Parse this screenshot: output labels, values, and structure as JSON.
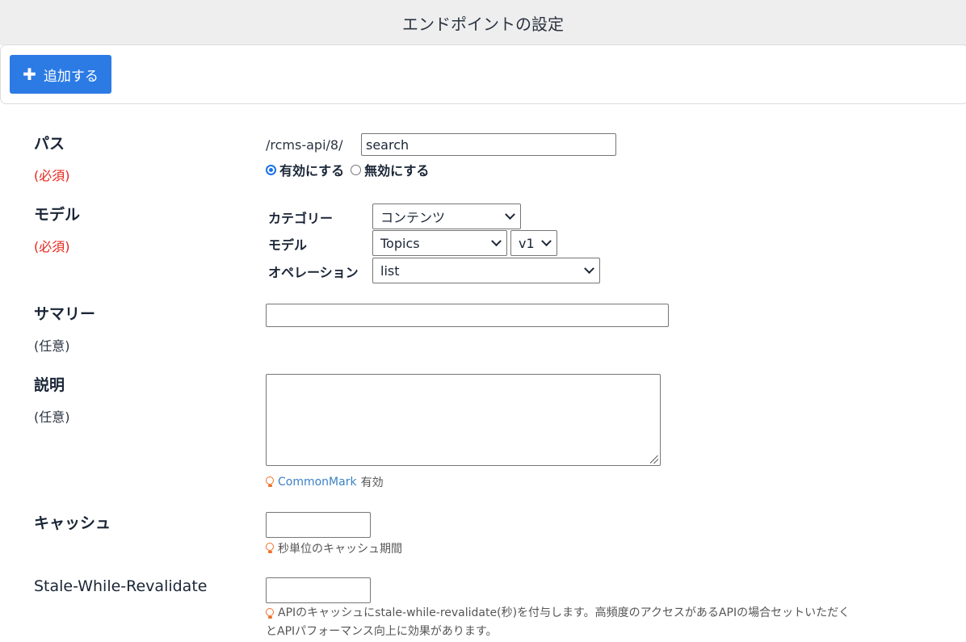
{
  "header": {
    "title": "エンドポイントの設定"
  },
  "toolbar": {
    "add_label": "追加する",
    "add_icon": "plus-icon"
  },
  "fields": {
    "path": {
      "label": "パス",
      "required": "(必須)",
      "prefix": "/rcms-api/8/",
      "value": "search",
      "radio_enable": "有効にする",
      "radio_disable": "無効にする",
      "selected": "enable"
    },
    "model": {
      "label": "モデル",
      "required": "(必須)",
      "category_label": "カテゴリー",
      "category_value": "コンテンツ",
      "model_label": "モデル",
      "model_value": "Topics",
      "version_value": "v1",
      "operation_label": "オペレーション",
      "operation_value": "list"
    },
    "summary": {
      "label": "サマリー",
      "optional": "(任意)",
      "value": ""
    },
    "description": {
      "label": "説明",
      "optional": "(任意)",
      "value": "",
      "hint_link": "CommonMark",
      "hint_text": "有効"
    },
    "cache": {
      "label": "キャッシュ",
      "value": "",
      "hint": "秒単位のキャッシュ期間"
    },
    "swr": {
      "label": "Stale-While-Revalidate",
      "value": "",
      "hint_line1": "APIのキャッシュにstale-while-revalidate(秒)を付与します。高頻度のアクセスがあるAPIの場合セットいただく",
      "hint_line2": "とAPIパフォーマンス向上に効果があります。"
    }
  },
  "colors": {
    "accent": "#2c7be5",
    "required": "#e8241b",
    "link": "#3b82c4",
    "hint_icon": "#f07028"
  }
}
